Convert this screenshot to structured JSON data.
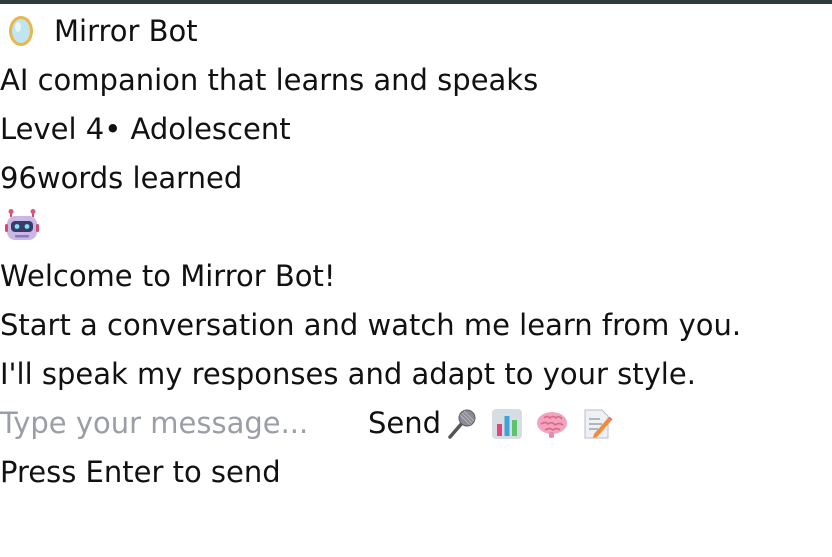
{
  "app": {
    "title": "Mirror Bot",
    "title_icon": "mirror-icon",
    "subtitle": "AI companion that learns and speaks",
    "level_label": "Level 4• Adolescent",
    "words_label": "96words learned"
  },
  "welcome": {
    "icon": "robot-icon",
    "heading": "Welcome to Mirror Bot!",
    "line1": "Start a conversation and watch me learn from you.",
    "line2": "I'll speak my responses and adapt to your style."
  },
  "composer": {
    "placeholder": "Type your message...",
    "send_label": "Send",
    "icons": [
      "microphone-icon",
      "bar-chart-icon",
      "brain-icon",
      "memo-icon"
    ],
    "hint": "Press Enter to send"
  },
  "colors": {
    "topbar": "#2f3b3a",
    "text": "#111111",
    "placeholder": "#9a9ea6"
  }
}
